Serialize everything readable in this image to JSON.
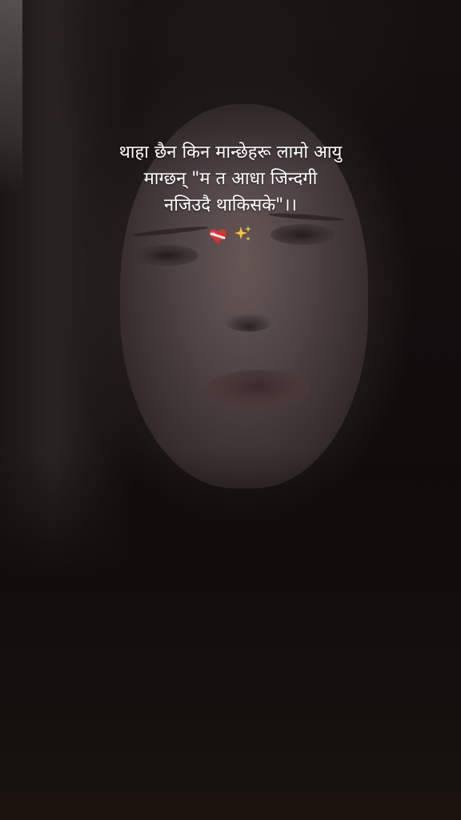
{
  "caption": {
    "line1": "थाहा छैन किन मान्छेहरू लामो आयु",
    "line2": "माग्छन् \"म त आधा जिन्दगी",
    "line3": "नजिउदै थाकिसके\"।।"
  },
  "icons": {
    "heart": "mending-heart-icon",
    "sparkles": "sparkles-icon"
  },
  "colors": {
    "text": "#ffffff",
    "background": "#0b0a0a",
    "heart": "#d9323c",
    "sparkles": "#f5c542"
  }
}
